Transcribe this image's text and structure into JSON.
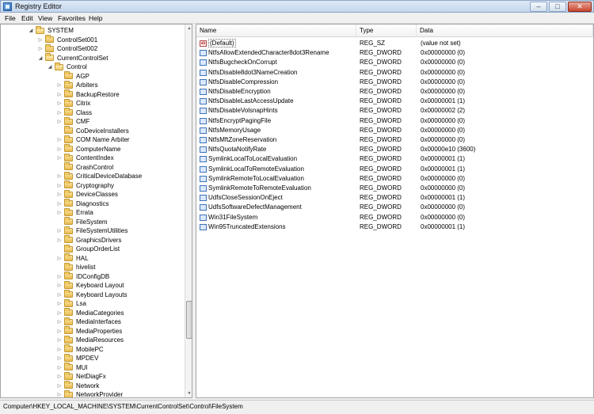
{
  "window": {
    "title": "Registry Editor",
    "minimize": "–",
    "maximize": "□",
    "close": "✕"
  },
  "menu": [
    "File",
    "Edit",
    "View",
    "Favorites",
    "Help"
  ],
  "tree": [
    {
      "label": "SYSTEM",
      "level": 0,
      "expander": "expanded",
      "open": true
    },
    {
      "label": "ControlSet001",
      "level": 1,
      "expander": "collapsed"
    },
    {
      "label": "ControlSet002",
      "level": 1,
      "expander": "collapsed"
    },
    {
      "label": "CurrentControlSet",
      "level": 1,
      "expander": "expanded",
      "open": true
    },
    {
      "label": "Control",
      "level": 2,
      "expander": "expanded",
      "open": true
    },
    {
      "label": "AGP",
      "level": 3,
      "expander": "none"
    },
    {
      "label": "Arbiters",
      "level": 3,
      "expander": "collapsed"
    },
    {
      "label": "BackupRestore",
      "level": 3,
      "expander": "collapsed"
    },
    {
      "label": "Citrix",
      "level": 3,
      "expander": "collapsed"
    },
    {
      "label": "Class",
      "level": 3,
      "expander": "collapsed"
    },
    {
      "label": "CMF",
      "level": 3,
      "expander": "collapsed"
    },
    {
      "label": "CoDeviceInstallers",
      "level": 3,
      "expander": "none"
    },
    {
      "label": "COM Name Arbiter",
      "level": 3,
      "expander": "collapsed"
    },
    {
      "label": "ComputerName",
      "level": 3,
      "expander": "collapsed"
    },
    {
      "label": "ContentIndex",
      "level": 3,
      "expander": "collapsed"
    },
    {
      "label": "CrashControl",
      "level": 3,
      "expander": "none"
    },
    {
      "label": "CriticalDeviceDatabase",
      "level": 3,
      "expander": "collapsed"
    },
    {
      "label": "Cryptography",
      "level": 3,
      "expander": "collapsed"
    },
    {
      "label": "DeviceClasses",
      "level": 3,
      "expander": "collapsed"
    },
    {
      "label": "Diagnostics",
      "level": 3,
      "expander": "collapsed"
    },
    {
      "label": "Errata",
      "level": 3,
      "expander": "collapsed"
    },
    {
      "label": "FileSystem",
      "level": 3,
      "expander": "none"
    },
    {
      "label": "FileSystemUtilities",
      "level": 3,
      "expander": "collapsed"
    },
    {
      "label": "GraphicsDrivers",
      "level": 3,
      "expander": "collapsed"
    },
    {
      "label": "GroupOrderList",
      "level": 3,
      "expander": "none"
    },
    {
      "label": "HAL",
      "level": 3,
      "expander": "collapsed"
    },
    {
      "label": "hivelist",
      "level": 3,
      "expander": "none"
    },
    {
      "label": "IDConfigDB",
      "level": 3,
      "expander": "collapsed"
    },
    {
      "label": "Keyboard Layout",
      "level": 3,
      "expander": "collapsed"
    },
    {
      "label": "Keyboard Layouts",
      "level": 3,
      "expander": "collapsed"
    },
    {
      "label": "Lsa",
      "level": 3,
      "expander": "collapsed"
    },
    {
      "label": "MediaCategories",
      "level": 3,
      "expander": "collapsed"
    },
    {
      "label": "MediaInterfaces",
      "level": 3,
      "expander": "collapsed"
    },
    {
      "label": "MediaProperties",
      "level": 3,
      "expander": "collapsed"
    },
    {
      "label": "MediaResources",
      "level": 3,
      "expander": "collapsed"
    },
    {
      "label": "MobilePC",
      "level": 3,
      "expander": "collapsed"
    },
    {
      "label": "MPDEV",
      "level": 3,
      "expander": "collapsed"
    },
    {
      "label": "MUI",
      "level": 3,
      "expander": "collapsed"
    },
    {
      "label": "NetDiagFx",
      "level": 3,
      "expander": "collapsed"
    },
    {
      "label": "Network",
      "level": 3,
      "expander": "collapsed"
    },
    {
      "label": "NetworkProvider",
      "level": 3,
      "expander": "collapsed"
    }
  ],
  "list": {
    "columns": [
      "Name",
      "Type",
      "Data"
    ],
    "rows": [
      {
        "name": "(Default)",
        "type": "REG_SZ",
        "data": "(value not set)",
        "kind": "sz",
        "selected": true
      },
      {
        "name": "NtfsAllowExtendedCharacter8dot3Rename",
        "type": "REG_DWORD",
        "data": "0x00000000 (0)",
        "kind": "dword"
      },
      {
        "name": "NtfsBugcheckOnCorrupt",
        "type": "REG_DWORD",
        "data": "0x00000000 (0)",
        "kind": "dword"
      },
      {
        "name": "NtfsDisable8dot3NameCreation",
        "type": "REG_DWORD",
        "data": "0x00000000 (0)",
        "kind": "dword"
      },
      {
        "name": "NtfsDisableCompression",
        "type": "REG_DWORD",
        "data": "0x00000000 (0)",
        "kind": "dword"
      },
      {
        "name": "NtfsDisableEncryption",
        "type": "REG_DWORD",
        "data": "0x00000000 (0)",
        "kind": "dword"
      },
      {
        "name": "NtfsDisableLastAccessUpdate",
        "type": "REG_DWORD",
        "data": "0x00000001 (1)",
        "kind": "dword"
      },
      {
        "name": "NtfsDisableVolsnapHints",
        "type": "REG_DWORD",
        "data": "0x00000002 (2)",
        "kind": "dword"
      },
      {
        "name": "NtfsEncryptPagingFile",
        "type": "REG_DWORD",
        "data": "0x00000000 (0)",
        "kind": "dword"
      },
      {
        "name": "NtfsMemoryUsage",
        "type": "REG_DWORD",
        "data": "0x00000000 (0)",
        "kind": "dword"
      },
      {
        "name": "NtfsMftZoneReservation",
        "type": "REG_DWORD",
        "data": "0x00000000 (0)",
        "kind": "dword"
      },
      {
        "name": "NtfsQuotaNotifyRate",
        "type": "REG_DWORD",
        "data": "0x00000e10 (3600)",
        "kind": "dword"
      },
      {
        "name": "SymlinkLocalToLocalEvaluation",
        "type": "REG_DWORD",
        "data": "0x00000001 (1)",
        "kind": "dword"
      },
      {
        "name": "SymlinkLocalToRemoteEvaluation",
        "type": "REG_DWORD",
        "data": "0x00000001 (1)",
        "kind": "dword"
      },
      {
        "name": "SymlinkRemoteToLocalEvaluation",
        "type": "REG_DWORD",
        "data": "0x00000000 (0)",
        "kind": "dword"
      },
      {
        "name": "SymlinkRemoteToRemoteEvaluation",
        "type": "REG_DWORD",
        "data": "0x00000000 (0)",
        "kind": "dword"
      },
      {
        "name": "UdfsCloseSessionOnEject",
        "type": "REG_DWORD",
        "data": "0x00000001 (1)",
        "kind": "dword"
      },
      {
        "name": "UdfsSoftwareDefectManagement",
        "type": "REG_DWORD",
        "data": "0x00000000 (0)",
        "kind": "dword"
      },
      {
        "name": "Win31FileSystem",
        "type": "REG_DWORD",
        "data": "0x00000000 (0)",
        "kind": "dword"
      },
      {
        "name": "Win95TruncatedExtensions",
        "type": "REG_DWORD",
        "data": "0x00000001 (1)",
        "kind": "dword"
      }
    ]
  },
  "status": {
    "path": "Computer\\HKEY_LOCAL_MACHINE\\SYSTEM\\CurrentControlSet\\Control\\FileSystem"
  },
  "icons": {
    "sz_glyph": "ab",
    "expand_glyph": "◢",
    "collapse_glyph": "▷",
    "scroll_up": "▲",
    "scroll_down": "▼"
  }
}
